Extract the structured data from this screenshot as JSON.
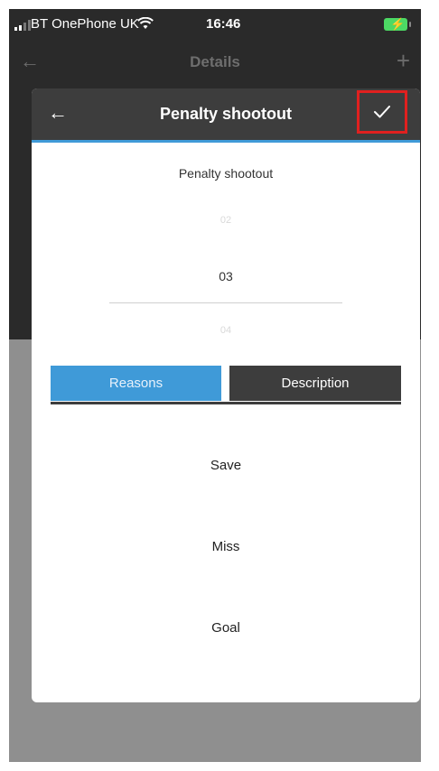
{
  "status_bar": {
    "carrier": "BT OnePhone UK",
    "time": "16:46",
    "battery_color": "#4cd964"
  },
  "nav": {
    "title": "Details",
    "back_icon": "arrow-left-icon",
    "add_icon": "plus-icon"
  },
  "dialog": {
    "header_title": "Penalty shootout",
    "back_icon": "arrow-left-icon",
    "confirm_icon": "checkmark-icon",
    "highlight_color": "#e0201f",
    "subtitle": "Penalty shootout",
    "picker": {
      "prev": "02",
      "selected": "03",
      "next": "04"
    },
    "tabs": [
      {
        "label": "Reasons",
        "active": true
      },
      {
        "label": "Description",
        "active": false
      }
    ],
    "reasons": [
      "Save",
      "Miss",
      "Goal"
    ],
    "accent_color": "#3f9ad8"
  }
}
